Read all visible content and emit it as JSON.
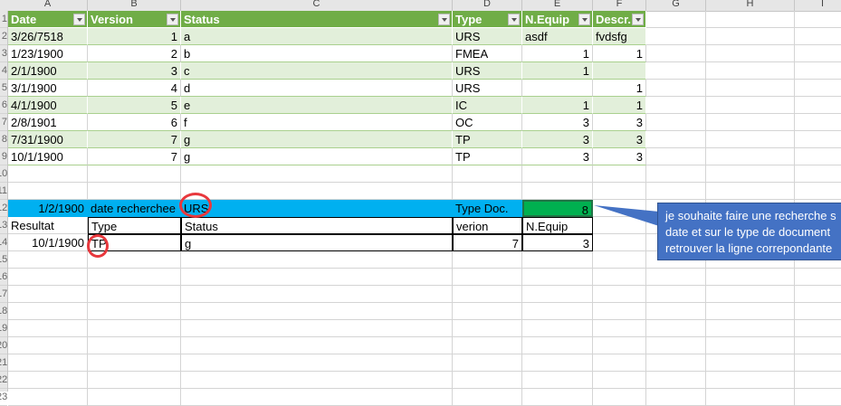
{
  "columns": [
    "A",
    "B",
    "C",
    "D",
    "E",
    "F",
    "G",
    "H",
    "I"
  ],
  "table": {
    "headers": [
      "Date",
      "Version",
      "Status",
      "Type",
      "N.Equip",
      "Descr."
    ],
    "rows": [
      [
        "3/26/7518",
        "1",
        "a",
        "URS",
        "asdf",
        "fvdsfg"
      ],
      [
        "1/23/1900",
        "2",
        "b",
        "FMEA",
        "1",
        "1"
      ],
      [
        "2/1/1900",
        "3",
        "c",
        "URS",
        "1",
        ""
      ],
      [
        "3/1/1900",
        "4",
        "d",
        "URS",
        "",
        "1"
      ],
      [
        "4/1/1900",
        "5",
        "e",
        "IC",
        "1",
        "1"
      ],
      [
        "2/8/1901",
        "6",
        "f",
        "OC",
        "3",
        "3"
      ],
      [
        "7/31/1900",
        "7",
        "g",
        "TP",
        "3",
        "3"
      ],
      [
        "10/1/1900",
        "7",
        "g",
        "TP",
        "3",
        "3"
      ]
    ]
  },
  "search": {
    "date": "1/2/1900",
    "date_label": "date recherchee",
    "type": "URS",
    "type_label": "Type Doc.",
    "count": "8"
  },
  "result": {
    "headers": [
      "Resultat",
      "Type",
      "Status",
      "verion",
      "N.Equip"
    ],
    "values": [
      "10/1/1900",
      "TP",
      "g",
      "7",
      "3"
    ]
  },
  "callout": {
    "text_lines": [
      "je souhaite faire une recherche s",
      "date et sur le type de document",
      "retrouver la ligne correpondante"
    ]
  }
}
